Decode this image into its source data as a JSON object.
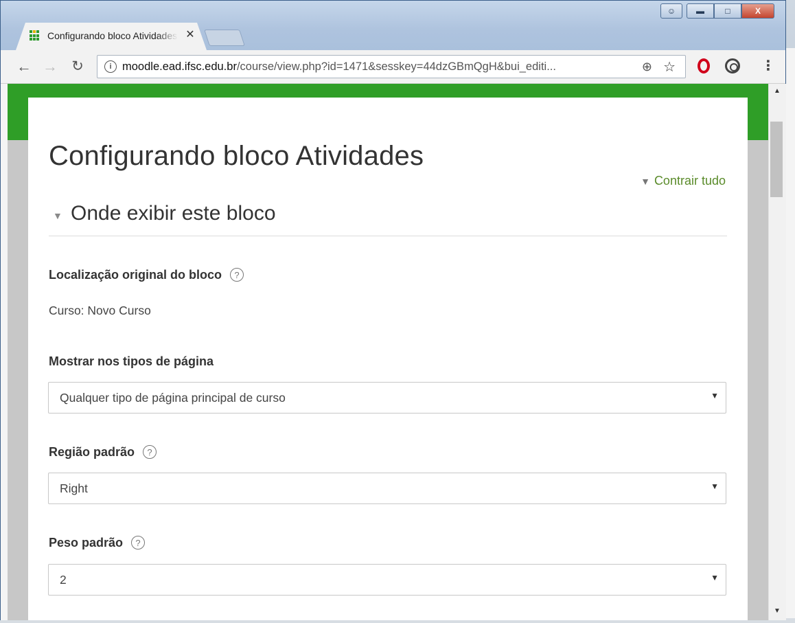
{
  "browser": {
    "tab_title": "Configurando bloco Atividades",
    "close_glyph": "✕",
    "url_host": "moodle.ead.ifsc.edu.br",
    "url_path": "/course/view.php?id=1471&sesskey=44dzGBmQgH&bui_editi...",
    "icons": [
      "moodle-favicon",
      "back-icon",
      "forward-icon",
      "reload-icon",
      "info-icon",
      "zoom-icon",
      "star-icon",
      "opera-icon",
      "extension-icon",
      "menu-icon",
      "user-icon",
      "minimize-icon",
      "maximize-icon",
      "close-icon"
    ]
  },
  "page": {
    "title": "Configurando bloco Atividades",
    "collapse_all": "Contrair tudo",
    "section_title": "Onde exibir este bloco",
    "fields": {
      "original_location": {
        "label": "Localização original do bloco",
        "value": "Curso: Novo Curso"
      },
      "page_types": {
        "label": "Mostrar nos tipos de página",
        "value": "Qualquer tipo de página principal de curso"
      },
      "default_region": {
        "label": "Região padrão",
        "value": "Right"
      },
      "default_weight": {
        "label": "Peso padrão",
        "value": "2"
      }
    }
  },
  "colors": {
    "accent_green": "#2f9e27",
    "link_green": "#5a8b2a",
    "text": "#333333"
  }
}
